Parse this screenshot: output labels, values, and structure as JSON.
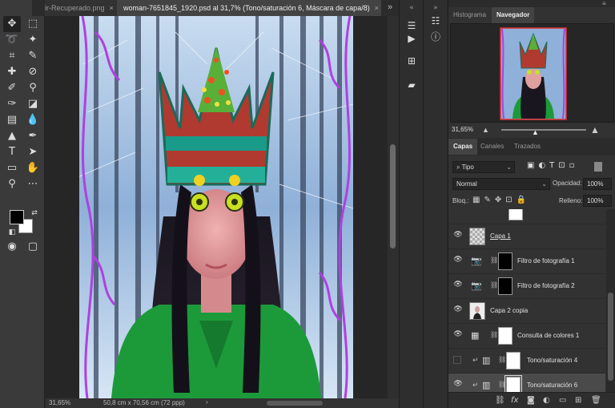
{
  "tabs": [
    {
      "label": "ir-Recuperado.png",
      "close": "×"
    },
    {
      "label": "woman-7651845_1920.psd al 31,7% (Tono/saturación 6, Máscara de capa/8)",
      "close": "×"
    }
  ],
  "tab_overflow": "»",
  "status": {
    "zoom": "31,65%",
    "dimensions": "50,8 cm x 70,56 cm (72 ppp)",
    "arrow": "›"
  },
  "panel_tabs_top": [
    "Histograma",
    "Navegador"
  ],
  "navigator": {
    "zoom": "31,65%"
  },
  "panel_tabs_layers": [
    "Capas",
    "Canales",
    "Trazados"
  ],
  "layers_panel": {
    "filter": "Tipo",
    "blend_mode": "Normal",
    "opacity_label": "Opacidad:",
    "opacity_value": "100%",
    "lock_label": "Bloq.:",
    "fill_label": "Relleno:",
    "fill_value": "100%"
  },
  "layers": [
    {
      "name": "Capa 1",
      "visible": true
    },
    {
      "name": "Filtro de fotografía 1",
      "visible": true
    },
    {
      "name": "Filtro de fotografía 2",
      "visible": true
    },
    {
      "name": "Capa 2 copia",
      "visible": true
    },
    {
      "name": "Consulta de colores 1",
      "visible": true
    },
    {
      "name": "Tono/saturación 4",
      "visible": false
    },
    {
      "name": "Tono/saturación 6",
      "visible": true,
      "selected": true
    }
  ],
  "colors": {
    "foreground": "#000000",
    "background": "#ffffff",
    "panel": "#323232",
    "selected_layer": "#4a4a4a",
    "navigator_frame": "#e03030"
  },
  "icons": {
    "move": "move-icon",
    "lasso": "lasso-icon",
    "eye": "eye-icon",
    "link": "link-icon"
  }
}
